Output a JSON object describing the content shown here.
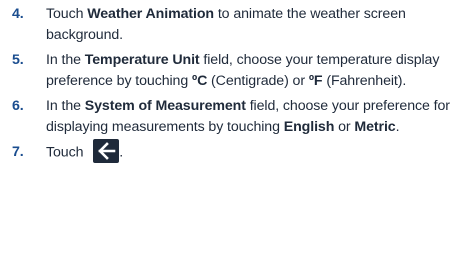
{
  "steps": [
    {
      "num": "4.",
      "parts": [
        "Touch ",
        "Weather Animation",
        " to animate the weather screen background."
      ]
    },
    {
      "num": "5.",
      "parts": [
        "In the ",
        "Temperature Unit",
        " field, choose your temperature display preference by touching ",
        "ºC",
        " (Centigrade) or ",
        "ºF",
        " (Fahrenheit)."
      ]
    },
    {
      "num": "6.",
      "parts": [
        "In the ",
        "System of Measurement",
        " field, choose your preference for displaying measurements by touching ",
        "English",
        " or ",
        "Metric",
        "."
      ]
    },
    {
      "num": "7.",
      "parts": [
        "Touch ",
        "."
      ],
      "icon": "back-arrow-icon"
    }
  ]
}
